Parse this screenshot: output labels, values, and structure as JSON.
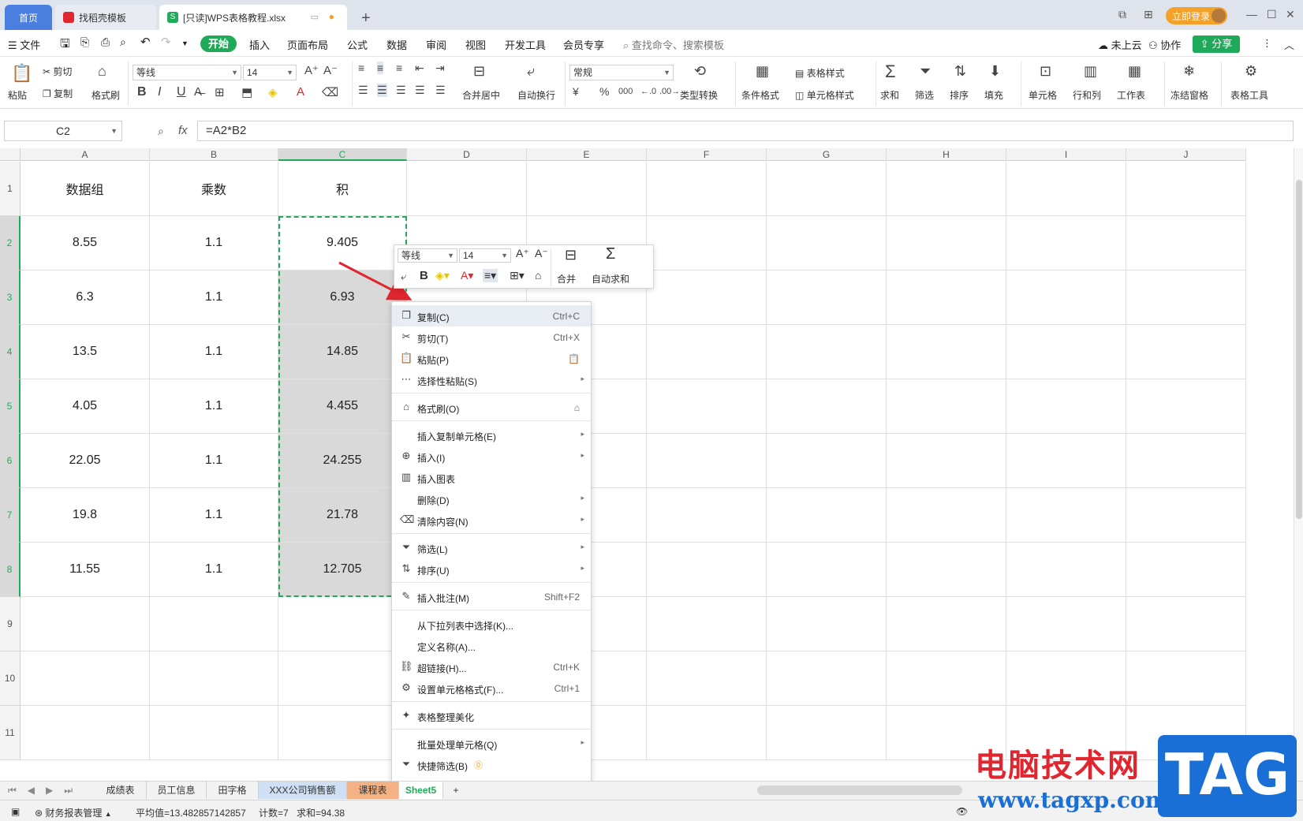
{
  "tabs": [
    {
      "label": "首页"
    },
    {
      "label": "找稻壳模板"
    },
    {
      "label": "[只读]WPS表格教程.xlsx"
    }
  ],
  "titlebar": {
    "login": "立即登录"
  },
  "menu": {
    "file": "文件",
    "items": [
      "开始",
      "插入",
      "页面布局",
      "公式",
      "数据",
      "审阅",
      "视图",
      "开发工具",
      "会员专享"
    ],
    "search_placeholder": "查找命令、搜索模板",
    "cloud": "未上云",
    "collab": "协作",
    "share": "分享"
  },
  "ribbon": {
    "paste": "粘贴",
    "cut": "剪切",
    "copy": "复制",
    "format_painter": "格式刷",
    "font": "等线",
    "size": "14",
    "merge_center": "合并居中",
    "wrap": "自动换行",
    "number_format": "常规",
    "type_convert": "类型转换",
    "cond_format": "条件格式",
    "table_style": "表格样式",
    "cell_style": "单元格样式",
    "sum": "求和",
    "filter": "筛选",
    "sort": "排序",
    "fill": "填充",
    "cell": "单元格",
    "row_col": "行和列",
    "worksheet": "工作表",
    "freeze": "冻结窗格",
    "table_tools": "表格工具",
    "currency": "¥",
    "percent": "%",
    "thousands": "000",
    "bold": "B",
    "italic": "I",
    "underline": "U"
  },
  "formula_bar": {
    "name_box": "C2",
    "fx": "fx",
    "formula": "=A2*B2"
  },
  "columns": [
    "A",
    "B",
    "C",
    "D",
    "E",
    "F",
    "G",
    "H",
    "I",
    "J"
  ],
  "rows": [
    "1",
    "2",
    "3",
    "4",
    "5",
    "6",
    "7",
    "8",
    "9",
    "10",
    "11"
  ],
  "table": {
    "headers": [
      "数据组",
      "乘数",
      "积"
    ],
    "data": [
      [
        "8.55",
        "1.1",
        "9.405"
      ],
      [
        "6.3",
        "1.1",
        "6.93"
      ],
      [
        "13.5",
        "1.1",
        "14.85"
      ],
      [
        "4.05",
        "1.1",
        "4.455"
      ],
      [
        "22.05",
        "1.1",
        "24.255"
      ],
      [
        "19.8",
        "1.1",
        "21.78"
      ],
      [
        "11.55",
        "1.1",
        "12.705"
      ]
    ]
  },
  "mini_toolbar": {
    "font": "等线",
    "size": "14",
    "merge": "合并",
    "autosum": "自动求和"
  },
  "context_menu": {
    "items": [
      {
        "label": "复制(C)",
        "shortcut": "Ctrl+C",
        "icon": "copy-icon"
      },
      {
        "label": "剪切(T)",
        "shortcut": "Ctrl+X",
        "icon": "cut-icon"
      },
      {
        "label": "粘贴(P)",
        "shortcut": "",
        "icon": "paste-icon"
      },
      {
        "label": "选择性粘贴(S)",
        "shortcut": "",
        "icon": "paste-special-icon"
      },
      {
        "label": "格式刷(O)",
        "shortcut": "",
        "icon": "brush-icon"
      },
      {
        "label": "插入复制单元格(E)",
        "shortcut": "",
        "icon": ""
      },
      {
        "label": "插入(I)",
        "shortcut": "",
        "icon": "insert-icon"
      },
      {
        "label": "插入图表",
        "shortcut": "",
        "icon": "chart-icon"
      },
      {
        "label": "删除(D)",
        "shortcut": "",
        "icon": ""
      },
      {
        "label": "清除内容(N)",
        "shortcut": "",
        "icon": "eraser-icon"
      },
      {
        "label": "筛选(L)",
        "shortcut": "",
        "icon": "filter-icon"
      },
      {
        "label": "排序(U)",
        "shortcut": "",
        "icon": "sort-icon"
      },
      {
        "label": "插入批注(M)",
        "shortcut": "Shift+F2",
        "icon": "comment-icon"
      },
      {
        "label": "从下拉列表中选择(K)...",
        "shortcut": "",
        "icon": ""
      },
      {
        "label": "定义名称(A)...",
        "shortcut": "",
        "icon": ""
      },
      {
        "label": "超链接(H)...",
        "shortcut": "Ctrl+K",
        "icon": "link-icon"
      },
      {
        "label": "设置单元格格式(F)...",
        "shortcut": "Ctrl+1",
        "icon": "format-cell-icon"
      },
      {
        "label": "表格整理美化",
        "shortcut": "",
        "icon": "beautify-icon"
      },
      {
        "label": "批量处理单元格(Q)",
        "shortcut": "",
        "icon": ""
      },
      {
        "label": "快捷筛选(B)",
        "shortcut": "",
        "icon": "quick-filter-icon"
      }
    ]
  },
  "sheet_tabs": [
    "成绩表",
    "员工信息",
    "田字格",
    "XXX公司销售额",
    "课程表",
    "Sheet5"
  ],
  "status": {
    "sheet_name": "财务报表管理",
    "average": "平均值=13.482857142857",
    "count": "计数=7",
    "sum": "求和=94.38"
  },
  "watermark": {
    "text": "电脑技术网",
    "url": "www.tagxp.com",
    "logo": "TAG"
  },
  "colors": {
    "accent": "#1faa59",
    "tab_blue": "#4a7fe0",
    "login": "#f3a12b",
    "watermark_red": "#e0262f",
    "watermark_blue": "#1a6fd6"
  }
}
